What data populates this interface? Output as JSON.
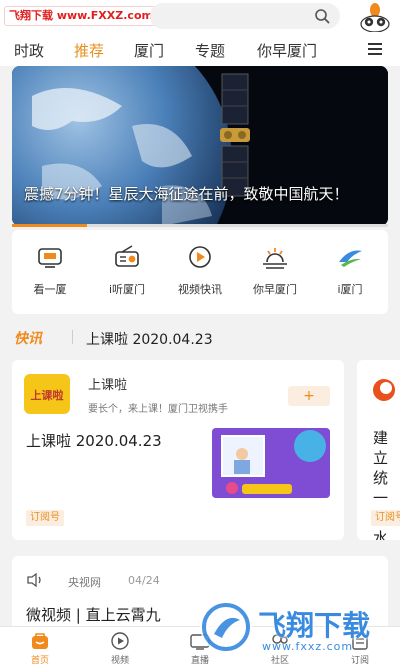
{
  "watermark": {
    "text": "飞翔下载 www.FXXZ.com"
  },
  "nav": {
    "tabs": [
      {
        "label": "时政"
      },
      {
        "label": "推荐"
      },
      {
        "label": "厦门"
      },
      {
        "label": "专题"
      },
      {
        "label": "你早厦门"
      }
    ],
    "active_index": 1
  },
  "hero": {
    "caption": "震撼7分钟！星辰大海征途在前，致敬中国航天！",
    "progress": 0.2
  },
  "quick_links": [
    {
      "label": "看一厦",
      "icon": "tv-icon"
    },
    {
      "label": "i听厦门",
      "icon": "radio-icon"
    },
    {
      "label": "视频快讯",
      "icon": "play-circle-icon"
    },
    {
      "label": "你早厦门",
      "icon": "sunrise-icon"
    },
    {
      "label": "i厦门",
      "icon": "i-xiamen-logo-icon"
    }
  ],
  "flash": {
    "logo": "快讯",
    "text": "上课啦 2020.04.23"
  },
  "card1": {
    "logo_text": "上课啦",
    "account": "上课啦",
    "description": "要长个，来上课！厦门卫视携手",
    "follow": "+",
    "title": "上课啦 2020.04.23",
    "tag": "订阅号"
  },
  "card2": {
    "text": "建立统一污水",
    "tag": "订阅号"
  },
  "card3": {
    "source": "央视网",
    "date": "04/24",
    "title": "微视频 | 直上云霄九"
  },
  "bottom_nav": [
    {
      "label": "首页",
      "icon": "home-icon"
    },
    {
      "label": "视频",
      "icon": "video-icon"
    },
    {
      "label": "直播",
      "icon": "live-icon"
    },
    {
      "label": "社区",
      "icon": "community-icon"
    },
    {
      "label": "订阅",
      "icon": "subscribe-icon"
    }
  ],
  "colors": {
    "accent": "#f08a1c",
    "active_tab": "#e8901e",
    "watermark": "#e02020",
    "brand_blue": "#3a8be0"
  },
  "overlay_watermark": {
    "text": "飞翔下载",
    "url": "www.fxxz.com"
  }
}
